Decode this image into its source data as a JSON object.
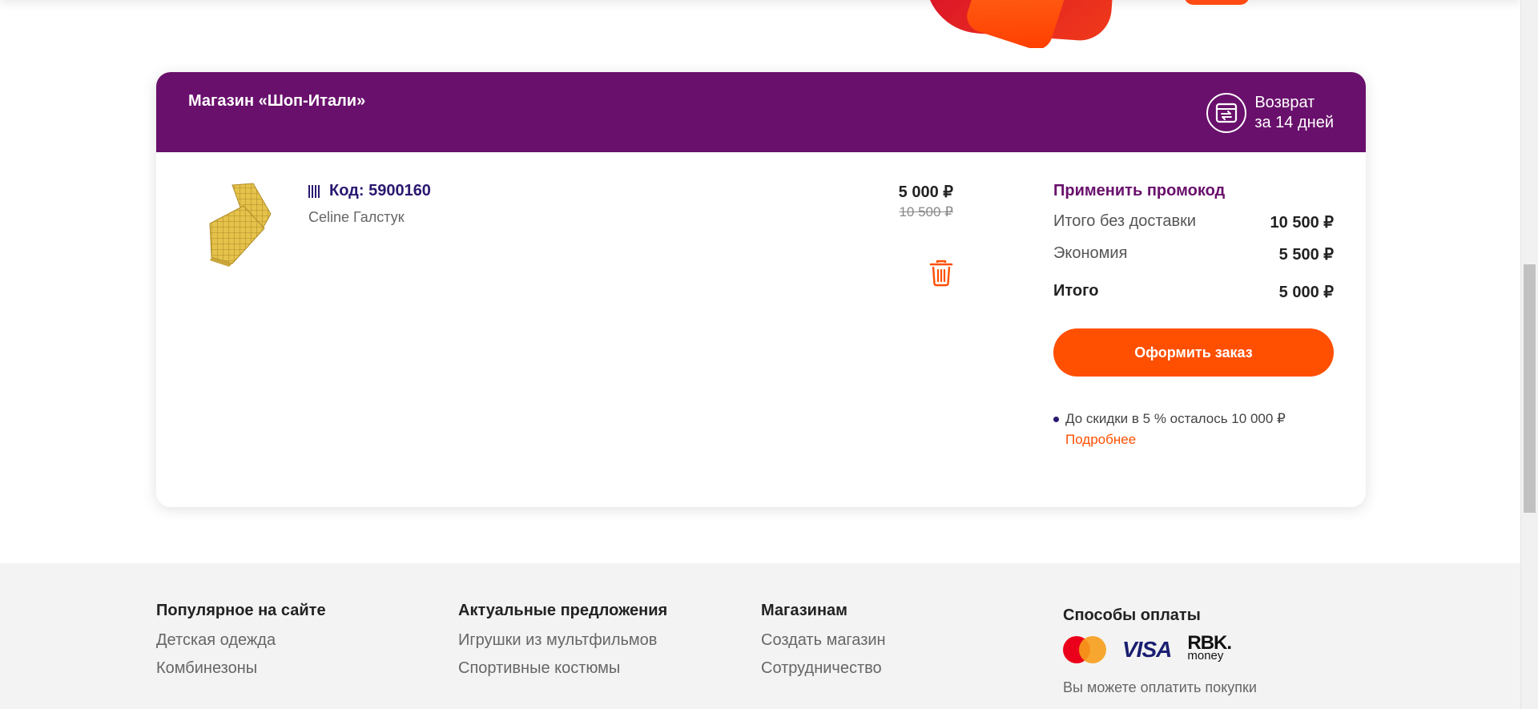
{
  "store": {
    "name": "Магазин «Шоп-Итали»",
    "return_line1": "Возврат",
    "return_line2": "за 14 дней"
  },
  "item": {
    "code": "Код: 5900160",
    "name": "Celine Галстук",
    "price": "5 000 ₽",
    "old_price": "10 500 ₽"
  },
  "summary": {
    "promo_label": "Применить промокод",
    "subtotal_label": "Итого без доставки",
    "subtotal_value": "10 500 ₽",
    "savings_label": "Экономия",
    "savings_value": "5 500 ₽",
    "total_label": "Итого",
    "total_value": "5 000 ₽",
    "checkout_label": "Оформить заказ",
    "discount_note": "До скидки в 5 % осталось 10 000 ₽",
    "more_link": "Подробнее"
  },
  "footer": {
    "popular": {
      "title": "Популярное на сайте",
      "links": [
        "Детская одежда",
        "Комбинезоны"
      ]
    },
    "offers": {
      "title": "Актуальные предложения",
      "links": [
        "Игрушки из мультфильмов",
        "Спортивные костюмы"
      ]
    },
    "shops": {
      "title": "Магазинам",
      "links": [
        "Создать магазин",
        "Сотрудничество"
      ]
    },
    "payment": {
      "title": "Способы оплаты",
      "visa": "VISA",
      "rbk_top": "RBK.",
      "rbk_bottom": "money",
      "text": "Вы можете оплатить покупки"
    }
  },
  "colors": {
    "brand_purple": "#69106c",
    "accent_orange": "#ff4f00",
    "code_blue": "#2b1870"
  }
}
